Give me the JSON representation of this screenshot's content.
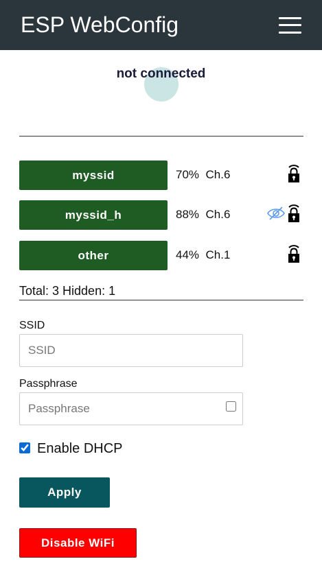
{
  "header": {
    "title": "ESP WebConfig",
    "menu_icon": "hamburger-menu-icon",
    "background_color": "#2b353c"
  },
  "connection": {
    "status_text": "not connected"
  },
  "networks": [
    {
      "ssid": "myssid",
      "signal": "70%",
      "channel": "Ch.6",
      "hidden": false,
      "secured": true
    },
    {
      "ssid": "myssid_h",
      "signal": "88%",
      "channel": "Ch.6",
      "hidden": true,
      "secured": true
    },
    {
      "ssid": "other",
      "signal": "44%",
      "channel": "Ch.1",
      "hidden": false,
      "secured": true
    }
  ],
  "summary": {
    "text": "Total: 3 Hidden: 1"
  },
  "form": {
    "ssid_label": "SSID",
    "ssid_placeholder": "SSID",
    "ssid_value": "",
    "pass_label": "Passphrase",
    "pass_placeholder": "Passphrase",
    "pass_value": "",
    "show_password_checked": false,
    "dhcp_label": "Enable DHCP",
    "dhcp_checked": true,
    "apply_label": "Apply",
    "disable_wifi_label": "Disable WiFi"
  },
  "colors": {
    "network_button": "#1e5c24",
    "apply_button": "#08575e",
    "disable_wifi_button": "#ff0000",
    "hidden_icon": "#5b9bea"
  },
  "icons": {
    "secure": "wifi-lock-icon",
    "hidden": "eye-slash-icon"
  }
}
